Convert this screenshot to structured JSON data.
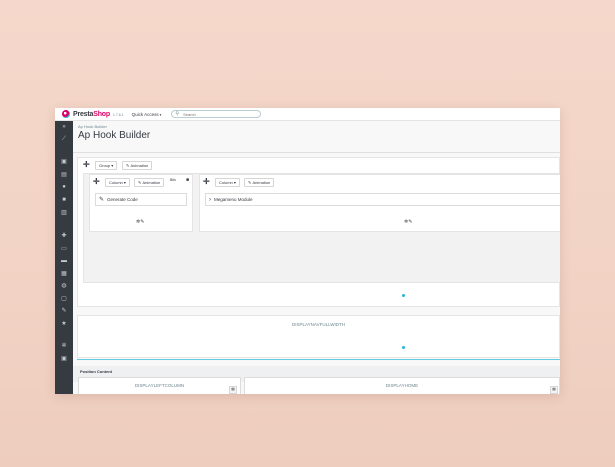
{
  "topbar": {
    "logo_main": "Presta",
    "logo_accent": "Shop",
    "version": "1.7.6.1",
    "quick_access": "Quick Access",
    "search_placeholder": "Search"
  },
  "sidebar": {
    "icons": [
      "collapse-icon",
      "stats-icon",
      "orders-icon",
      "catalog-icon",
      "customers-icon",
      "messages-icon",
      "stats-bars-icon",
      "modules-icon",
      "design-icon",
      "shipping-icon",
      "payment-icon",
      "international-icon",
      "advanced-icon",
      "appearance-icon",
      "favorite-icon",
      "settings-icon",
      "shop-icon"
    ]
  },
  "header": {
    "breadcrumb": "Ap Hook Builder",
    "title": "Ap Hook Builder"
  },
  "builder": {
    "group_label": "Group",
    "animation_label": "Animation",
    "column_label": "Column",
    "col1_widget": "Generate Code",
    "col2_widget": "Megamenu Module",
    "mini_label": "Bits"
  },
  "hooks": {
    "nav_full_width": "DISPLAYNAVFULLWIDTH",
    "position_content": "Position Content",
    "left_column": "DISPLAYLEFTCOLUMN",
    "home": "DISPLAYHOME"
  },
  "colors": {
    "accent": "#25b9d7",
    "brand": "#df0067",
    "sidebar_bg": "#363a41"
  }
}
